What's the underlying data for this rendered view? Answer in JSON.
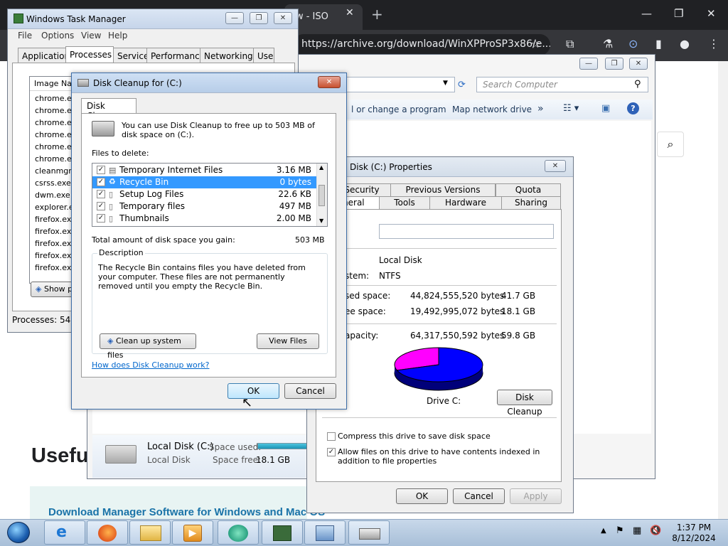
{
  "chrome": {
    "tab_title": "ow - ISO",
    "url": "https://archive.org/download/WinXPProSP3x86/e...",
    "page_heading": "Usefu",
    "page_link": "Download Manager Software for Windows and Mac OS"
  },
  "task_manager": {
    "title": "Windows Task Manager",
    "menu": [
      "File",
      "Options",
      "View",
      "Help"
    ],
    "tabs": [
      "Applications",
      "Processes",
      "Services",
      "Performance",
      "Networking",
      "Users"
    ],
    "column_header": "Image Name",
    "processes": [
      "chrome.exe",
      "chrome.exe",
      "chrome.exe",
      "chrome.exe",
      "chrome.exe",
      "chrome.exe",
      "cleanmgr.exe",
      "csrss.exe",
      "dwm.exe",
      "explorer.exe",
      "firefox.exe",
      "firefox.exe",
      "firefox.exe",
      "firefox.exe",
      "firefox.exe"
    ],
    "show_button": "Show p",
    "status": "Processes: 54"
  },
  "explorer": {
    "search_placeholder": "Search Computer",
    "cmd_uninstall": "l or change a program",
    "cmd_map": "Map network drive",
    "cmd_more": "»",
    "details_name": "Local Disk (C:)",
    "details_type": "Local Disk",
    "space_used_label": "Space used:",
    "space_free_label": "Space free:",
    "space_free_value": "18.1 GB"
  },
  "disk_cleanup": {
    "title": "Disk Cleanup for  (C:)",
    "tab": "Disk Cleanup",
    "intro": "You can use Disk Cleanup to free up to 503 MB of disk space on  (C:).",
    "files_label": "Files to delete:",
    "files": [
      {
        "name": "Temporary Internet Files",
        "size": "3.16 MB",
        "checked": "✓"
      },
      {
        "name": "Recycle Bin",
        "size": "0 bytes",
        "checked": "✓"
      },
      {
        "name": "Setup Log Files",
        "size": "22.6 KB",
        "checked": "✓"
      },
      {
        "name": "Temporary files",
        "size": "497 MB",
        "checked": "✓"
      },
      {
        "name": "Thumbnails",
        "size": "2.00 MB",
        "checked": "✓"
      }
    ],
    "total_label": "Total amount of disk space you gain:",
    "total_value": "503 MB",
    "description_label": "Description",
    "description_text": "The Recycle Bin contains files you have deleted from your computer. These files are not permanently removed until you empty the Recycle Bin.",
    "cleanup_system_button": "Clean up system files",
    "view_files_button": "View Files",
    "help_link": "How does Disk Cleanup work?",
    "ok_button": "OK",
    "cancel_button": "Cancel"
  },
  "properties": {
    "title": "Disk (C:) Properties",
    "tabs_row1": [
      "Security",
      "Previous Versions",
      "Quota"
    ],
    "tabs_row2": [
      "General",
      "Tools",
      "Hardware",
      "Sharing"
    ],
    "type_value": "Local Disk",
    "fs_label": "stem:",
    "fs_value": "NTFS",
    "used_label": "sed space:",
    "used_bytes": "44,824,555,520 bytes",
    "used_gb": "41.7 GB",
    "free_label": "ee space:",
    "free_bytes": "19,492,995,072 bytes",
    "free_gb": "18.1 GB",
    "capacity_label": "apacity:",
    "capacity_bytes": "64,317,550,592 bytes",
    "capacity_gb": "59.8 GB",
    "drive_label": "Drive C:",
    "disk_cleanup_button": "Disk Cleanup",
    "compress_label": "Compress this drive to save disk space",
    "index_label": "Allow files on this drive to have contents indexed in addition to file properties",
    "ok_button": "OK",
    "cancel_button": "Cancel",
    "apply_button": "Apply",
    "used_fraction": 0.697
  },
  "taskbar": {
    "time": "1:37 PM",
    "date": "8/12/2024"
  }
}
